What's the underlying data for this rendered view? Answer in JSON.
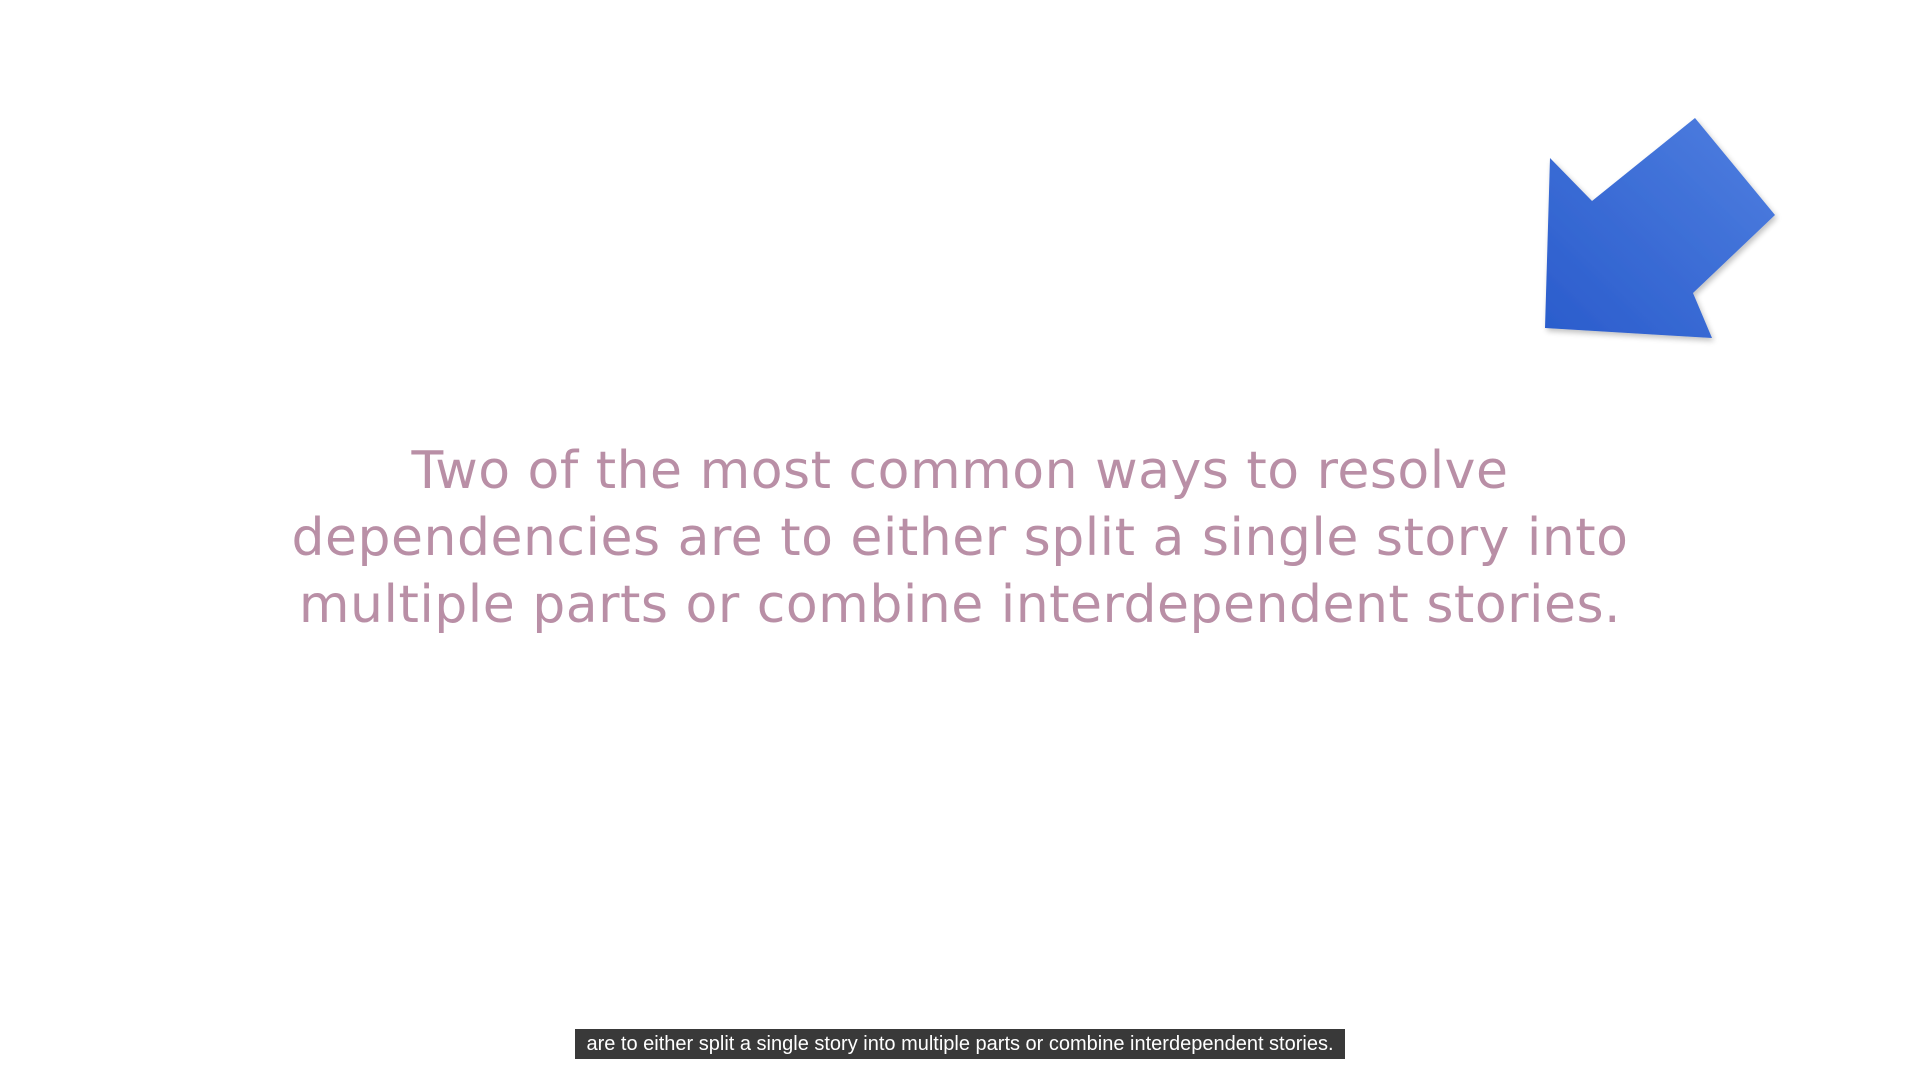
{
  "slide": {
    "main_text": "Two of the most common ways to resolve\ndependencies are to either split a single story into\nmultiple parts or combine interdependent stories.",
    "text_color": "#b98fa6",
    "background_color": "#ffffff",
    "arrow": {
      "icon": "blue-arrow-icon",
      "pointing": "down-left",
      "color_light": "#4f7fe0",
      "color_dark": "#2a5ccc"
    }
  },
  "video": {
    "caption": "are to either split a single story into multiple parts or combine interdependent stories."
  }
}
